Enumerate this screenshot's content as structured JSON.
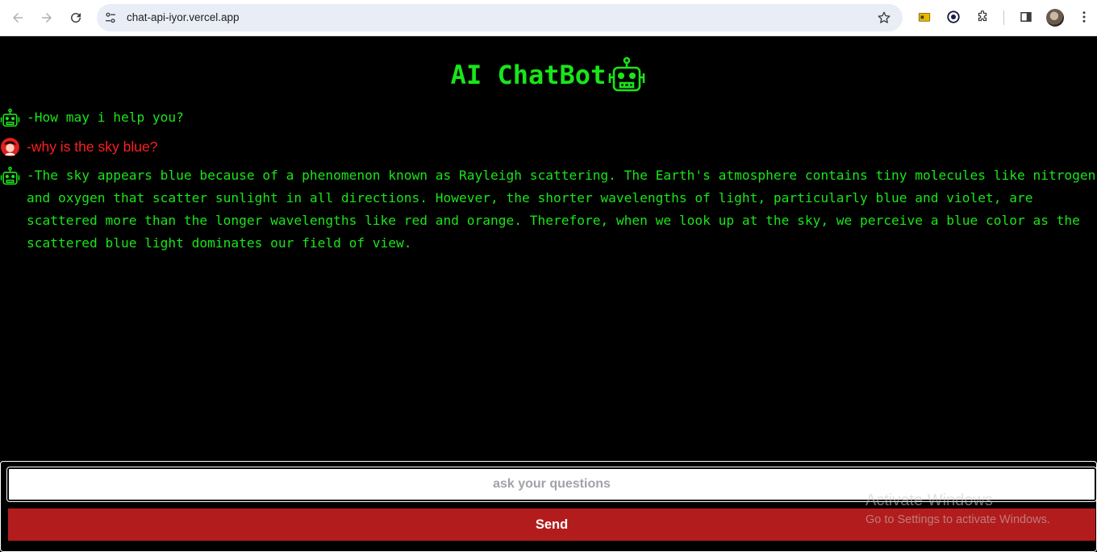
{
  "browser": {
    "url": "chat-api-iyor.vercel.app",
    "icons": [
      "back-arrow-icon",
      "forward-arrow-icon",
      "reload-icon",
      "site-settings-icon",
      "bookmark-star-icon",
      "extension-folder-icon",
      "sync-icon",
      "extensions-puzzle-icon",
      "side-panel-icon",
      "profile-avatar",
      "more-menu-icon"
    ]
  },
  "app": {
    "title": "AI ChatBot",
    "accent_color": "#19e519",
    "user_color": "#ff1f1f",
    "button_color": "#b31c1c"
  },
  "messages": [
    {
      "role": "bot",
      "icon": "robot-icon",
      "text": "-How may i help you?"
    },
    {
      "role": "user",
      "icon": "user-avatar-icon",
      "text": "-why is the sky blue?"
    },
    {
      "role": "bot",
      "icon": "robot-icon",
      "text": "-The sky appears blue because of a phenomenon known as Rayleigh scattering. The Earth's atmosphere contains tiny molecules like nitrogen and oxygen that scatter sunlight in all directions. However, the shorter wavelengths of light, particularly blue and violet, are scattered more than the longer wavelengths like red and orange. Therefore, when we look up at the sky, we perceive a blue color as the scattered blue light dominates our field of view."
    }
  ],
  "input": {
    "placeholder": "ask your questions",
    "value": ""
  },
  "send_button": {
    "label": "Send"
  },
  "watermark": {
    "title": "Activate Windows",
    "subtitle": "Go to Settings to activate Windows."
  }
}
